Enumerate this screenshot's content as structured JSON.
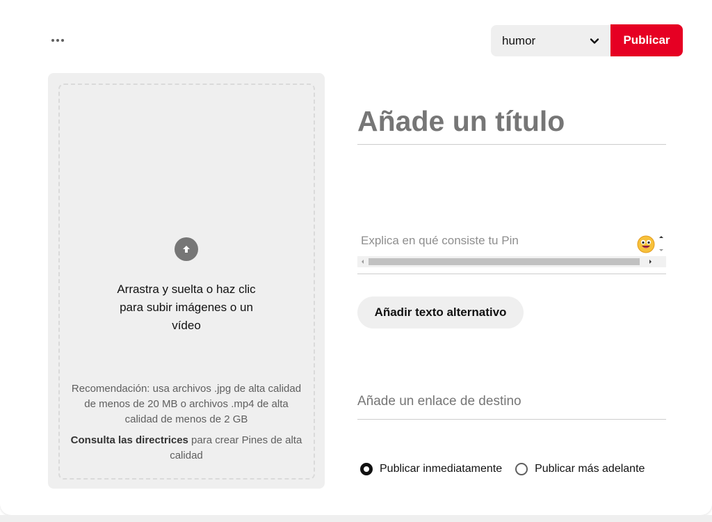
{
  "header": {
    "more_icon": "more-horizontal-icon",
    "board_select_value": "humor",
    "publish_label": "Publicar",
    "accent_color": "#e60023"
  },
  "upload": {
    "icon": "arrow-up-icon",
    "instruction": "Arrastra y suelta o haz clic para subir imágenes o un vídeo",
    "recommendation": "Recomendación: usa archivos .jpg de alta calidad de menos de 20 MB o archivos .mp4 de alta calidad de menos de 2 GB",
    "guidelines_link": "Consulta las directrices",
    "guidelines_rest": " para crear Pines de alta calidad"
  },
  "form": {
    "title_placeholder": "Añade un título",
    "description_placeholder": "Explica en qué consiste tu Pin",
    "emoji_icon": "emoji-smile-icon",
    "alt_text_button": "Añadir texto alternativo",
    "link_placeholder": "Añade un enlace de destino",
    "publish_options": [
      {
        "label": "Publicar inmediatamente",
        "selected": true
      },
      {
        "label": "Publicar más adelante",
        "selected": false
      }
    ]
  }
}
